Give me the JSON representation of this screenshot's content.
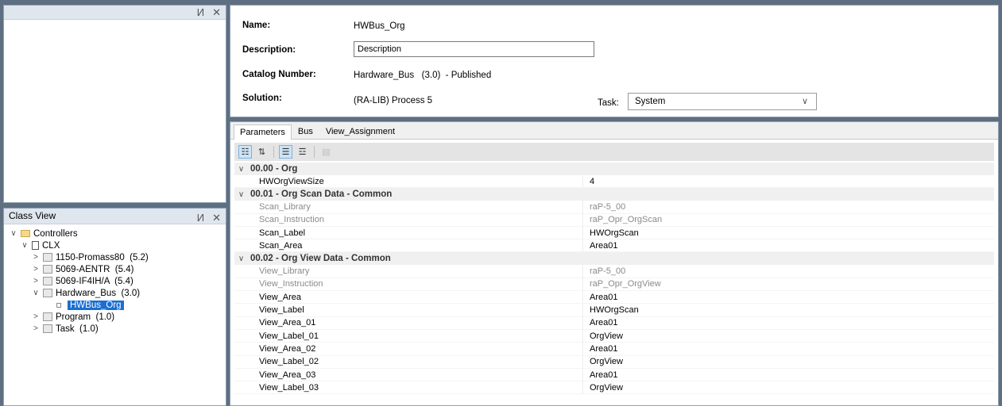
{
  "class_view": {
    "title": "Class View",
    "tree": [
      {
        "label": "Controllers",
        "level": 0,
        "expanded": true,
        "icon": "folder-icon"
      },
      {
        "label": "CLX",
        "level": 1,
        "expanded": true,
        "icon": "controller-icon"
      },
      {
        "label": "1150-Promass80  (5.2)",
        "level": 2,
        "expanded": false,
        "icon": "module-icon"
      },
      {
        "label": "5069-AENTR  (5.4)",
        "level": 2,
        "expanded": false,
        "icon": "module-icon"
      },
      {
        "label": "5069-IF4IH/A  (5.4)",
        "level": 2,
        "expanded": false,
        "icon": "module-icon"
      },
      {
        "label": "Hardware_Bus  (3.0)",
        "level": 2,
        "expanded": true,
        "icon": "module-icon"
      },
      {
        "label": "HWBus_Org",
        "level": 3,
        "selected": true,
        "icon": "instance-icon"
      },
      {
        "label": "Program  (1.0)",
        "level": 2,
        "expanded": false,
        "icon": "module-icon"
      },
      {
        "label": "Task  (1.0)",
        "level": 2,
        "expanded": false,
        "icon": "module-icon"
      }
    ]
  },
  "props": {
    "name_label": "Name:",
    "name_value": "HWBus_Org",
    "desc_label": "Description:",
    "desc_value": "Description",
    "catalog_label": "Catalog Number:",
    "catalog_value": "Hardware_Bus   (3.0)  - Published",
    "solution_label": "Solution:",
    "solution_value": "(RA-LIB) Process 5",
    "task_label": "Task:",
    "task_value": "System"
  },
  "tabs": [
    "Parameters",
    "Bus",
    "View_Assignment"
  ],
  "grid": [
    {
      "category": "00.00 - Org",
      "rows": [
        {
          "k": "HWOrgViewSize",
          "v": "4",
          "ro": false
        }
      ]
    },
    {
      "category": "00.01 - Org Scan Data - Common",
      "rows": [
        {
          "k": "Scan_Library",
          "v": "raP-5_00",
          "ro": true
        },
        {
          "k": "Scan_Instruction",
          "v": "raP_Opr_OrgScan",
          "ro": true
        },
        {
          "k": "Scan_Label",
          "v": "HWOrgScan",
          "ro": false
        },
        {
          "k": "Scan_Area",
          "v": "Area01",
          "ro": false
        }
      ]
    },
    {
      "category": "00.02 - Org View Data - Common",
      "rows": [
        {
          "k": "View_Library",
          "v": "raP-5_00",
          "ro": true
        },
        {
          "k": "View_Instruction",
          "v": "raP_Opr_OrgView",
          "ro": true
        },
        {
          "k": "View_Area",
          "v": "Area01",
          "ro": false
        },
        {
          "k": "View_Label",
          "v": "HWOrgScan",
          "ro": false
        },
        {
          "k": "View_Area_01",
          "v": "Area01",
          "ro": false
        },
        {
          "k": "View_Label_01",
          "v": "OrgView",
          "ro": false
        },
        {
          "k": "View_Area_02",
          "v": "Area01",
          "ro": false
        },
        {
          "k": "View_Label_02",
          "v": "OrgView",
          "ro": false
        },
        {
          "k": "View_Area_03",
          "v": "Area01",
          "ro": false
        },
        {
          "k": "View_Label_03",
          "v": "OrgView",
          "ro": false
        }
      ]
    }
  ],
  "pane_controls": {
    "pin": "И",
    "close": "✕"
  },
  "colors": {
    "selection": "#1b6ed2",
    "frame": "#5e6f82"
  }
}
